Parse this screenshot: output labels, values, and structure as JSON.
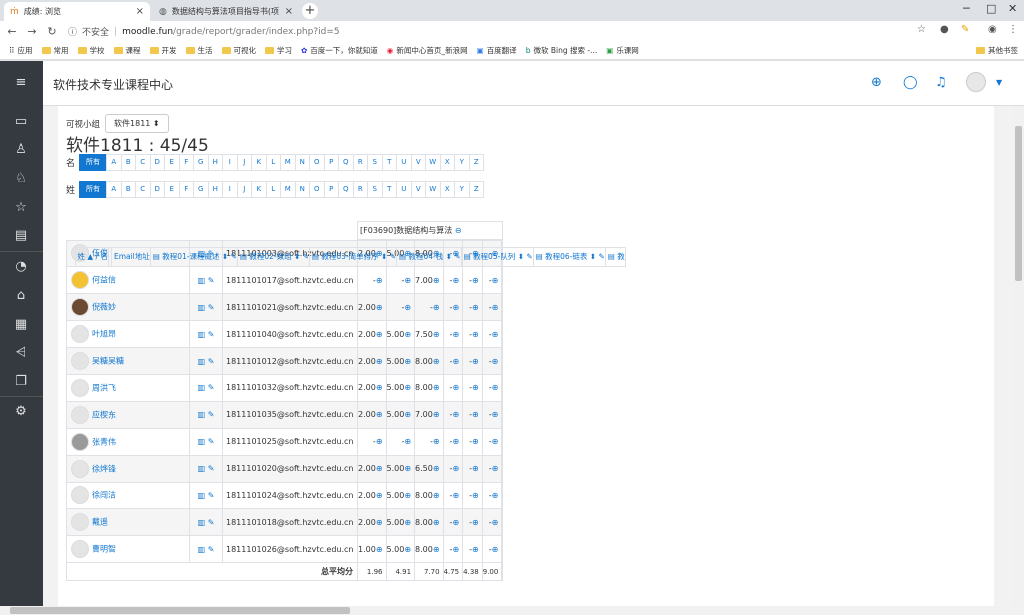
{
  "browser": {
    "tabs": [
      {
        "title": "成绩: 浏览",
        "active": true,
        "close": "×"
      },
      {
        "title": "数据结构与算法项目指导书(项目",
        "active": false,
        "close": "×"
      }
    ],
    "new_tab": "+",
    "security": "不安全",
    "url_host": "moodle.fun",
    "url_path": "/grade/report/grader/index.php?id=5",
    "bookmarks": [
      "应用",
      "常用",
      "学校",
      "课程",
      "开发",
      "生活",
      "可视化",
      "学习",
      "百度一下，你就知道",
      "新闻中心首页_新浪网",
      "百度翻译",
      "微软 Bing 搜索 -...",
      "乐课网"
    ],
    "other_bookmarks": "其他书签"
  },
  "site": {
    "name": "软件技术专业课程中心"
  },
  "group": {
    "label": "可视小组",
    "selected": "软件1811"
  },
  "heading": "软件1811 : 45/45",
  "initials": {
    "first_label": "名",
    "last_label": "姓",
    "all": "所有",
    "letters": [
      "A",
      "B",
      "C",
      "D",
      "E",
      "F",
      "G",
      "H",
      "I",
      "J",
      "K",
      "L",
      "M",
      "N",
      "O",
      "P",
      "Q",
      "R",
      "S",
      "T",
      "U",
      "V",
      "W",
      "X",
      "Y",
      "Z"
    ]
  },
  "table": {
    "course_header": "[F03690]数据结构与算法",
    "col_name": "姓 ▲ / 名",
    "col_email": "Email地址",
    "columns": [
      "教程01-课程概述",
      "教程02-数组",
      "教程03-简单排序",
      "教程04-栈",
      "教程05-队列",
      "教程06-链表",
      "教"
    ],
    "rows": [
      {
        "name": "伍俊",
        "email": "1811101003@soft.hzvtc.edu.cn",
        "grades": [
          "2.00",
          "5.00",
          "8.00",
          "-",
          "-",
          "-"
        ],
        "pic": ""
      },
      {
        "name": "何益信",
        "email": "1811101017@soft.hzvtc.edu.cn",
        "grades": [
          "-",
          "-",
          "7.00",
          "-",
          "-",
          "-"
        ],
        "pic": "crown"
      },
      {
        "name": "倪薇妙",
        "email": "1811101021@soft.hzvtc.edu.cn",
        "grades": [
          "2.00",
          "-",
          "-",
          "-",
          "-",
          "-"
        ],
        "pic": "dog"
      },
      {
        "name": "叶旭昂",
        "email": "1811101040@soft.hzvtc.edu.cn",
        "grades": [
          "2.00",
          "5.00",
          "7.50",
          "-",
          "-",
          "-"
        ],
        "pic": ""
      },
      {
        "name": "吴糖吴糖",
        "email": "1811101012@soft.hzvtc.edu.cn",
        "grades": [
          "2.00",
          "5.00",
          "8.00",
          "-",
          "-",
          "-"
        ],
        "pic": ""
      },
      {
        "name": "周洪飞",
        "email": "1811101032@soft.hzvtc.edu.cn",
        "grades": [
          "2.00",
          "5.00",
          "8.00",
          "-",
          "-",
          "-"
        ],
        "pic": ""
      },
      {
        "name": "应楔东",
        "email": "1811101035@soft.hzvtc.edu.cn",
        "grades": [
          "2.00",
          "5.00",
          "7.00",
          "-",
          "-",
          "-"
        ],
        "pic": ""
      },
      {
        "name": "张青伟",
        "email": "1811101025@soft.hzvtc.edu.cn",
        "grades": [
          "-",
          "-",
          "-",
          "-",
          "-",
          "-"
        ],
        "pic": "gray"
      },
      {
        "name": "徐烨锋",
        "email": "1811101020@soft.hzvtc.edu.cn",
        "grades": [
          "2.00",
          "5.00",
          "6.50",
          "-",
          "-",
          "-"
        ],
        "pic": ""
      },
      {
        "name": "徐闯洁",
        "email": "1811101024@soft.hzvtc.edu.cn",
        "grades": [
          "2.00",
          "5.00",
          "8.00",
          "-",
          "-",
          "-"
        ],
        "pic": ""
      },
      {
        "name": "戴遥",
        "email": "1811101018@soft.hzvtc.edu.cn",
        "grades": [
          "2.00",
          "5.00",
          "8.00",
          "-",
          "-",
          "-"
        ],
        "pic": ""
      },
      {
        "name": "曹明智",
        "email": "1811101026@soft.hzvtc.edu.cn",
        "grades": [
          "1.00",
          "5.00",
          "8.00",
          "-",
          "-",
          "-"
        ],
        "pic": ""
      }
    ],
    "footer_label": "总平均分",
    "averages": [
      "1.96",
      "4.91",
      "7.70",
      "4.75",
      "4.38",
      "9.00"
    ]
  }
}
